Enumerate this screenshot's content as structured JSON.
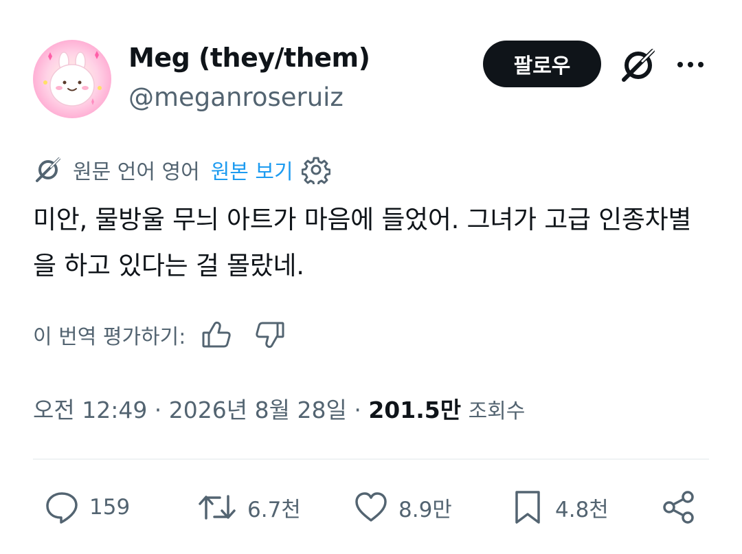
{
  "user": {
    "display_name": "Meg (they/them)",
    "handle": "@meganroseruiz",
    "avatar_icon": "bunny-avatar"
  },
  "header": {
    "follow_label": "팔로우",
    "grok_icon": "grok-icon",
    "more_icon": "more-icon"
  },
  "translation": {
    "source_language": "원문 언어 영어",
    "show_original": "원본 보기",
    "settings_icon": "gear-icon"
  },
  "tweet": {
    "text": "미안, 물방울 무늬 아트가 마음에 들었어. 그녀가 고급 인종차별을 하고 있다는 걸 몰랐네."
  },
  "rate": {
    "label": "이 번역 평가하기:",
    "up_icon": "thumbs-up-icon",
    "down_icon": "thumbs-down-icon"
  },
  "meta": {
    "time": "오전 12:49",
    "separator": " · ",
    "date": "2026년 8월 28일",
    "views_count": "201.5만",
    "views_label": "조회수"
  },
  "actions": {
    "replies": "159",
    "reposts": "6.7천",
    "likes": "8.9만",
    "bookmarks": "4.8천"
  },
  "colors": {
    "text": "#0f1419",
    "secondary": "#536471",
    "link": "#1d9bf0",
    "divider": "#eff3f4"
  }
}
